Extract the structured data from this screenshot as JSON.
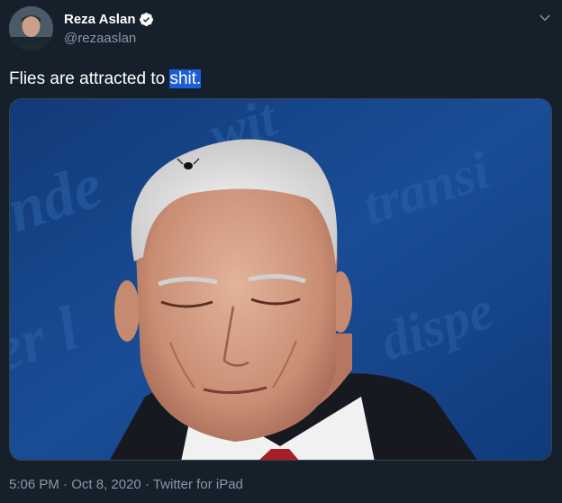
{
  "author": {
    "display_name": "Reza Aslan",
    "handle": "@rezaaslan",
    "verified": true,
    "avatar_icon": "user-avatar"
  },
  "tweet": {
    "text_before": "Flies are attracted to ",
    "text_highlighted": "shit.",
    "media_alt_icon": "photo"
  },
  "meta": {
    "time": "5:06 PM",
    "separator": " · ",
    "date": "Oct 8, 2020",
    "source": "Twitter for iPad"
  },
  "colors": {
    "background": "#15202b",
    "secondary_text": "#8899a6",
    "verified_blue": "#1da1f2",
    "selection": "#1a5fd6"
  },
  "background_words": [
    "Independence",
    "Transition",
    "Dispense",
    "Liberty"
  ]
}
